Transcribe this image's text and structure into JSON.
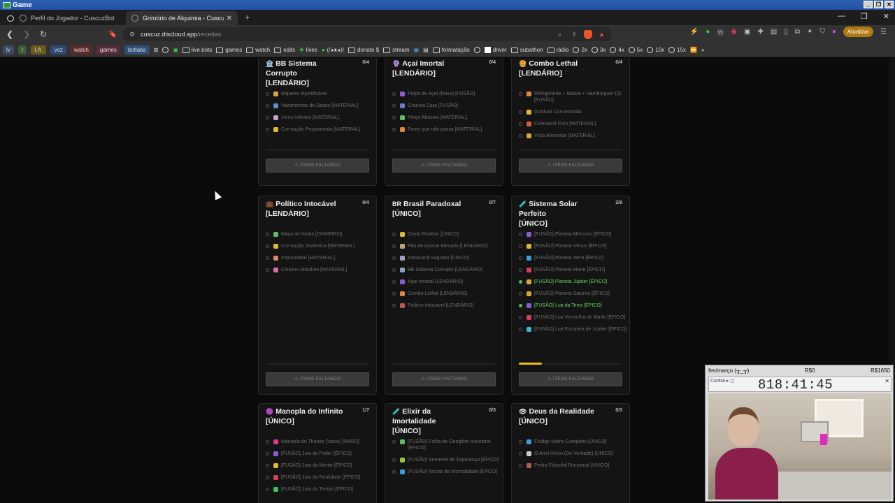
{
  "os_window": {
    "title": "Game"
  },
  "tabs": [
    {
      "label": "Perfil do Jogador - CuscuzBot",
      "active": false
    },
    {
      "label": "Grimório de Alquimia - Cuscuz",
      "active": true
    }
  ],
  "addressbar": {
    "domain": "cuscuz.discloud.app",
    "path": "/receitas",
    "update_label": "Atualizar"
  },
  "bookmarks": {
    "chips": [
      {
        "label": "lv",
        "bg": "#3b4a63"
      },
      {
        "label": "r",
        "bg": "#3d5c3a"
      },
      {
        "label": "I.A.",
        "bg": "#6b5a1e"
      },
      {
        "label": "voz",
        "bg": "#2f4a78"
      },
      {
        "label": "watch",
        "bg": "#5c2a2a"
      },
      {
        "label": "games",
        "bg": "#5a2a3a"
      },
      {
        "label": "botlabs",
        "bg": "#2d4f7a"
      }
    ],
    "items": [
      {
        "label": "live bots",
        "icon": "folder"
      },
      {
        "label": "games",
        "icon": "folder"
      },
      {
        "label": "watch",
        "icon": "folder"
      },
      {
        "label": "edits",
        "icon": "folder"
      },
      {
        "label": "lives",
        "icon": "plus"
      },
      {
        "label": "(/◕ᴥ◕)/",
        "icon": "circle"
      },
      {
        "label": "donate $",
        "icon": "folder"
      },
      {
        "label": "stream",
        "icon": "folder"
      },
      {
        "label": "formatação",
        "icon": "folder"
      },
      {
        "label": "driver",
        "icon": "square"
      },
      {
        "label": "subathon",
        "icon": "folder"
      },
      {
        "label": "rádio",
        "icon": "folder"
      },
      {
        "label": "2x",
        "icon": "circle"
      },
      {
        "label": "3x",
        "icon": "circle"
      },
      {
        "label": "4x",
        "icon": "circle"
      },
      {
        "label": "5x",
        "icon": "circle"
      },
      {
        "label": "10x",
        "icon": "circle"
      },
      {
        "label": "15x",
        "icon": "circle"
      }
    ]
  },
  "cards": [
    {
      "id": "bb",
      "emoji": "🏦",
      "title_line1": "BB Sistema Corrupto",
      "title_line2": "[LENDÁRIO]",
      "count": "0/4",
      "button": "⚠ ITENS FALTANDO",
      "ingredients": [
        {
          "text": "Riqueza Injustificável",
          "color": "#d9a441",
          "done": false
        },
        {
          "text": "Vazamentos de Dados [MATERIAL]",
          "color": "#5b8fd1",
          "done": false
        },
        {
          "text": "Juros Infinitos [MATERIAL]",
          "color": "#c5a3d9",
          "done": false
        },
        {
          "text": "Corrupção Programada [MATERIAL]",
          "color": "#e0b92e",
          "done": false
        }
      ]
    },
    {
      "id": "acai",
      "emoji": "🔮",
      "title_line1": "Açaí Imortal",
      "title_line2": "[LENDÁRIO]",
      "count": "0/4",
      "button": "⚠ ITENS FALTANDO",
      "ingredients": [
        {
          "text": "Polpa de Açaí (Roxa) [FUSÃO]",
          "color": "#8a5bd1",
          "done": false
        },
        {
          "text": "Granola Cara [FUSÃO]",
          "color": "#6f7bd1",
          "done": false
        },
        {
          "text": "Preço Abusivo [MATERIAL]",
          "color": "#5fbf5f",
          "done": false
        },
        {
          "text": "Fome que não passa [MATERIAL]",
          "color": "#e08a3c",
          "done": false
        }
      ]
    },
    {
      "id": "combo",
      "emoji": "🍔",
      "title_line1": "Combo Lethal",
      "title_line2": "[LENDÁRIO]",
      "count": "0/4",
      "button": "⚠ ITENS FALTANDO",
      "ingredients": [
        {
          "text": "Refrigerante + Batata + Hambúrguer (3) [FUSÃO]",
          "color": "#d98a3c",
          "done": false
        },
        {
          "text": "Gordura Concentrada",
          "color": "#e0b92e",
          "done": false
        },
        {
          "text": "Colesterol Puro [MATERIAL]",
          "color": "#d95b3c",
          "done": false
        },
        {
          "text": "Vício Alimentar [MATERIAL]",
          "color": "#e0a42e",
          "done": false
        }
      ]
    },
    {
      "id": "politico",
      "emoji": "💼",
      "title_line1": "Político Intocável",
      "title_line2": "[LENDÁRIO]",
      "count": "0/4",
      "button": "⚠ ITENS FALTANDO",
      "ingredients": [
        {
          "text": "Maço de Notas [DINHEIRO]",
          "color": "#5fbf5f",
          "done": false
        },
        {
          "text": "Corrupção Sistêmica [MATERIAL]",
          "color": "#e0b92e",
          "done": false
        },
        {
          "text": "Impunidade [MATERIAL]",
          "color": "#d98a5b",
          "done": false
        },
        {
          "text": "Cinismo Absoluto [MATERIAL]",
          "color": "#e06ab0",
          "done": false
        }
      ]
    },
    {
      "id": "brasil",
      "emoji": "BR",
      "title_line1": "Brasil Paradoxal",
      "title_line2": "[ÚNICO]",
      "count": "0/7",
      "button": "⚠ ITENS FALTANDO",
      "ingredients": [
        {
          "text": "Cristo Protetor [ÚNICO]",
          "color": "#e0b92e",
          "done": false
        },
        {
          "text": "Pão de Açúcar Elevado [LENDÁRIO]",
          "color": "#c5a37a",
          "done": false
        },
        {
          "text": "Maracanã Sagrado [ÚNICO]",
          "color": "#a0a0c0",
          "done": false
        },
        {
          "text": "BB Sistema Corrupto [LENDÁRIO]",
          "color": "#8fa0c0",
          "done": false
        },
        {
          "text": "Açaí Imortal [LENDÁRIO]",
          "color": "#8a5bd1",
          "done": false
        },
        {
          "text": "Combo Lethal [LENDÁRIO]",
          "color": "#d98a3c",
          "done": false
        },
        {
          "text": "Político Intocável [LENDÁRIO]",
          "color": "#b05b5b",
          "done": false
        }
      ]
    },
    {
      "id": "solar",
      "emoji": "🧪",
      "title_line1": "Sistema Solar Perfeito",
      "title_line2": "[ÚNICO]",
      "count": "2/9",
      "button": "⚠ ITENS FALTANDO",
      "progress": 0.22,
      "ingredients": [
        {
          "text": "[FUSÃO] Planeta Mercúrio [ÉPICO]",
          "color": "#8a5bd1",
          "done": false
        },
        {
          "text": "[FUSÃO] Planeta Vênus [ÉPICO]",
          "color": "#e0b92e",
          "done": false
        },
        {
          "text": "[FUSÃO] Planeta Terra [ÉPICO]",
          "color": "#3c9ed9",
          "done": false
        },
        {
          "text": "[FUSÃO] Planeta Marte [ÉPICO]",
          "color": "#d93c5b",
          "done": false
        },
        {
          "text": "[FUSÃO] Planeta Júpiter [ÉPICO]",
          "color": "#e0a42e",
          "done": true
        },
        {
          "text": "[FUSÃO] Planeta Saturno [ÉPICO]",
          "color": "#e0a42e",
          "done": false
        },
        {
          "text": "[FUSÃO] Lua da Terra [ÉPICO]",
          "color": "#8a5bd1",
          "done": true
        },
        {
          "text": "[FUSÃO] Lua Vermelha de Marte [ÉPICO]",
          "color": "#d93c5b",
          "done": false
        },
        {
          "text": "[FUSÃO] Lua Europeia de Júpiter [ÉPICO]",
          "color": "#3cb8d9",
          "done": false
        }
      ]
    },
    {
      "id": "manopla",
      "emoji": "🟣",
      "title_line1": "Manopla do Infinito",
      "title_line2": "[ÚNICO]",
      "count": "1/7",
      "button": "",
      "ingredients": [
        {
          "text": "Manopla do Thanos (Vazia) [RARO]",
          "color": "#d93c8a",
          "done": false
        },
        {
          "text": "[FUSÃO] Joia do Poder [ÉPICO]",
          "color": "#8a5bd1",
          "done": false
        },
        {
          "text": "[FUSÃO] Joia da Mente [ÉPICO]",
          "color": "#e0b92e",
          "done": false
        },
        {
          "text": "[FUSÃO] Joia da Realidade [ÉPICO]",
          "color": "#d93c5b",
          "done": false
        },
        {
          "text": "[FUSÃO] Joia do Tempo [ÉPICO]",
          "color": "#3cbf5f",
          "done": false
        }
      ]
    },
    {
      "id": "elixir",
      "emoji": "🧪",
      "title_line1": "Elixir da Imortalidade",
      "title_line2": "[ÚNICO]",
      "count": "0/3",
      "button": "",
      "ingredients": [
        {
          "text": "[FUSÃO] Folha de Gengibre Ancestral [ÉPICO]",
          "color": "#5fbf5f",
          "done": false
        },
        {
          "text": "[FUSÃO] Semente de Esperança [ÉPICO]",
          "color": "#a0c03c",
          "done": false
        },
        {
          "text": "[FUSÃO] Néctar da Imortalidade [ÉPICO]",
          "color": "#3c9ed9",
          "done": false
        }
      ]
    },
    {
      "id": "deus",
      "emoji": "👁",
      "title_line1": "Deus da Realidade",
      "title_line2": "[ÚNICO]",
      "count": "0/3",
      "button": "",
      "ingredients": [
        {
          "text": "Código Matrix Completo [ÚNICO]",
          "color": "#3c9ed9",
          "done": false
        },
        {
          "text": "O Anel Único (De Verdade) [ÚNICO]",
          "color": "#d0d0d0",
          "done": false
        },
        {
          "text": "Pedra Filosofal Funcional [ÚNICO]",
          "color": "#b05b5b",
          "done": false
        }
      ]
    }
  ],
  "overlay": {
    "left_label": "fev/março (╥_╥)",
    "mid_label": "R$0",
    "right_label": "R$1650",
    "timer_label": "Contra ▸ ◻",
    "timer_value": "818:41:45",
    "timer_close": "✕"
  }
}
